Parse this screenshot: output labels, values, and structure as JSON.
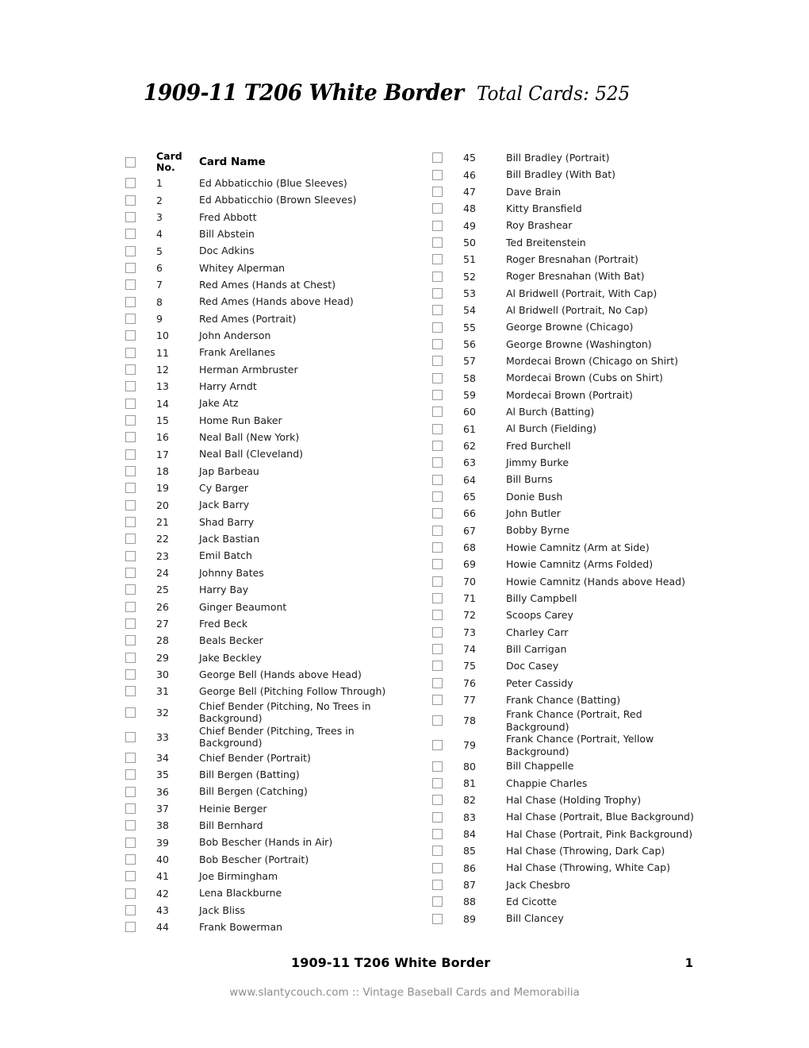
{
  "header": {
    "title": "1909-11 T206 White Border",
    "total_cards_label": "Total Cards: 525"
  },
  "table": {
    "columns": {
      "checkbox": "",
      "card_no": "Card No.",
      "card_no_line1": "Card",
      "card_no_line2": "No.",
      "card_name": "Card Name"
    }
  },
  "left_column": [
    {
      "no": "1",
      "name": "Ed Abbaticchio (Blue Sleeves)"
    },
    {
      "no": "2",
      "name": "Ed Abbaticchio (Brown Sleeves)"
    },
    {
      "no": "3",
      "name": "Fred Abbott"
    },
    {
      "no": "4",
      "name": "Bill Abstein"
    },
    {
      "no": "5",
      "name": "Doc Adkins"
    },
    {
      "no": "6",
      "name": "Whitey Alperman"
    },
    {
      "no": "7",
      "name": "Red Ames (Hands at Chest)"
    },
    {
      "no": "8",
      "name": "Red Ames (Hands above Head)"
    },
    {
      "no": "9",
      "name": "Red Ames (Portrait)"
    },
    {
      "no": "10",
      "name": "John Anderson"
    },
    {
      "no": "11",
      "name": "Frank Arellanes"
    },
    {
      "no": "12",
      "name": "Herman Armbruster"
    },
    {
      "no": "13",
      "name": "Harry Arndt"
    },
    {
      "no": "14",
      "name": "Jake Atz"
    },
    {
      "no": "15",
      "name": "Home Run Baker"
    },
    {
      "no": "16",
      "name": "Neal Ball (New York)"
    },
    {
      "no": "17",
      "name": "Neal Ball (Cleveland)"
    },
    {
      "no": "18",
      "name": "Jap Barbeau"
    },
    {
      "no": "19",
      "name": "Cy Barger"
    },
    {
      "no": "20",
      "name": "Jack Barry"
    },
    {
      "no": "21",
      "name": "Shad Barry"
    },
    {
      "no": "22",
      "name": "Jack Bastian"
    },
    {
      "no": "23",
      "name": "Emil Batch"
    },
    {
      "no": "24",
      "name": "Johnny Bates"
    },
    {
      "no": "25",
      "name": "Harry Bay"
    },
    {
      "no": "26",
      "name": "Ginger Beaumont"
    },
    {
      "no": "27",
      "name": "Fred Beck"
    },
    {
      "no": "28",
      "name": "Beals Becker"
    },
    {
      "no": "29",
      "name": "Jake Beckley"
    },
    {
      "no": "30",
      "name": "George Bell (Hands above Head)"
    },
    {
      "no": "31",
      "name": "George Bell (Pitching Follow Through)"
    },
    {
      "no": "32",
      "name": "Chief Bender (Pitching, No Trees in Background)"
    },
    {
      "no": "33",
      "name": "Chief Bender (Pitching, Trees in Background)"
    },
    {
      "no": "34",
      "name": "Chief Bender (Portrait)"
    },
    {
      "no": "35",
      "name": "Bill Bergen (Batting)"
    },
    {
      "no": "36",
      "name": "Bill Bergen (Catching)"
    },
    {
      "no": "37",
      "name": "Heinie Berger"
    },
    {
      "no": "38",
      "name": "Bill Bernhard"
    },
    {
      "no": "39",
      "name": "Bob Bescher (Hands in Air)"
    },
    {
      "no": "40",
      "name": "Bob Bescher (Portrait)"
    },
    {
      "no": "41",
      "name": "Joe Birmingham"
    },
    {
      "no": "42",
      "name": "Lena Blackburne"
    },
    {
      "no": "43",
      "name": "Jack Bliss"
    },
    {
      "no": "44",
      "name": "Frank Bowerman"
    }
  ],
  "right_column": [
    {
      "no": "45",
      "name": "Bill Bradley (Portrait)"
    },
    {
      "no": "46",
      "name": "Bill Bradley (With Bat)"
    },
    {
      "no": "47",
      "name": "Dave Brain"
    },
    {
      "no": "48",
      "name": "Kitty Bransfield"
    },
    {
      "no": "49",
      "name": "Roy Brashear"
    },
    {
      "no": "50",
      "name": "Ted Breitenstein"
    },
    {
      "no": "51",
      "name": "Roger Bresnahan (Portrait)"
    },
    {
      "no": "52",
      "name": "Roger Bresnahan (With Bat)"
    },
    {
      "no": "53",
      "name": "Al Bridwell (Portrait, With Cap)"
    },
    {
      "no": "54",
      "name": "Al Bridwell (Portrait, No Cap)"
    },
    {
      "no": "55",
      "name": "George Browne (Chicago)"
    },
    {
      "no": "56",
      "name": "George Browne (Washington)"
    },
    {
      "no": "57",
      "name": "Mordecai Brown (Chicago on Shirt)"
    },
    {
      "no": "58",
      "name": "Mordecai Brown (Cubs on Shirt)"
    },
    {
      "no": "59",
      "name": "Mordecai Brown (Portrait)"
    },
    {
      "no": "60",
      "name": "Al Burch (Batting)"
    },
    {
      "no": "61",
      "name": "Al Burch (Fielding)"
    },
    {
      "no": "62",
      "name": "Fred Burchell"
    },
    {
      "no": "63",
      "name": "Jimmy Burke"
    },
    {
      "no": "64",
      "name": "Bill Burns"
    },
    {
      "no": "65",
      "name": "Donie Bush"
    },
    {
      "no": "66",
      "name": "John Butler"
    },
    {
      "no": "67",
      "name": "Bobby Byrne"
    },
    {
      "no": "68",
      "name": "Howie Camnitz (Arm at Side)"
    },
    {
      "no": "69",
      "name": "Howie Camnitz (Arms Folded)"
    },
    {
      "no": "70",
      "name": "Howie Camnitz (Hands above Head)"
    },
    {
      "no": "71",
      "name": "Billy Campbell"
    },
    {
      "no": "72",
      "name": "Scoops Carey"
    },
    {
      "no": "73",
      "name": "Charley Carr"
    },
    {
      "no": "74",
      "name": "Bill Carrigan"
    },
    {
      "no": "75",
      "name": "Doc Casey"
    },
    {
      "no": "76",
      "name": "Peter Cassidy"
    },
    {
      "no": "77",
      "name": "Frank Chance (Batting)"
    },
    {
      "no": "78",
      "name": "Frank Chance (Portrait, Red Background)"
    },
    {
      "no": "79",
      "name": "Frank Chance (Portrait, Yellow Background)"
    },
    {
      "no": "80",
      "name": "Bill Chappelle"
    },
    {
      "no": "81",
      "name": "Chappie Charles"
    },
    {
      "no": "82",
      "name": "Hal Chase (Holding Trophy)"
    },
    {
      "no": "83",
      "name": "Hal Chase (Portrait, Blue Background)"
    },
    {
      "no": "84",
      "name": "Hal Chase (Portrait, Pink Background)"
    },
    {
      "no": "85",
      "name": "Hal Chase (Throwing, Dark Cap)"
    },
    {
      "no": "86",
      "name": "Hal Chase (Throwing, White Cap)"
    },
    {
      "no": "87",
      "name": "Jack Chesbro"
    },
    {
      "no": "88",
      "name": "Ed Cicotte"
    },
    {
      "no": "89",
      "name": "Bill Clancey"
    }
  ],
  "footer": {
    "title": "1909-11 T206 White Border",
    "page_number": "1",
    "website_line": "www.slantycouch.com :: Vintage Baseball Cards and Memorabilia"
  }
}
